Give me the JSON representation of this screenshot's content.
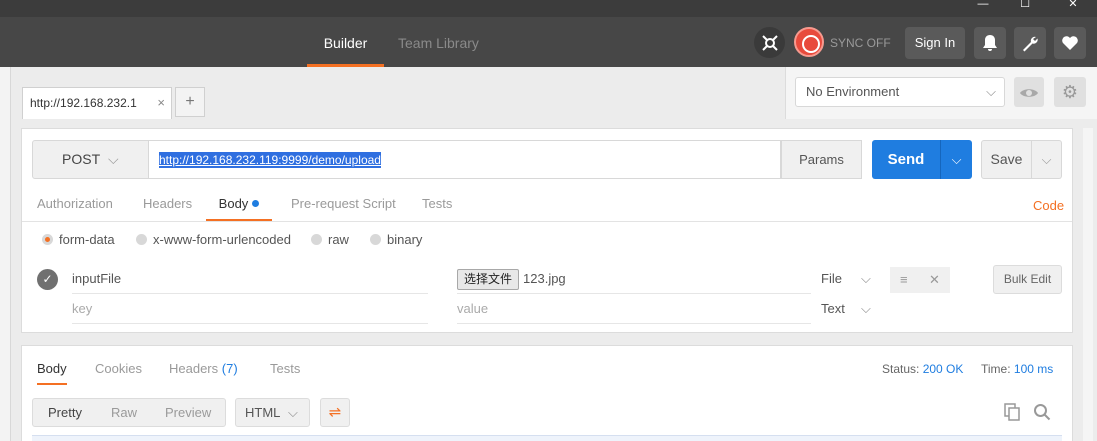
{
  "nav": {
    "builder": "Builder",
    "team_library": "Team Library",
    "sync": "SYNC OFF",
    "signin": "Sign In"
  },
  "tabs": {
    "request_tab": "http://192.168.232.1",
    "close": "×",
    "add": "+"
  },
  "environment": {
    "selected": "No Environment"
  },
  "request": {
    "method": "POST",
    "url": "http://192.168.232.119:9999/demo/upload",
    "params": "Params",
    "send": "Send",
    "save": "Save",
    "subtabs": [
      "Authorization",
      "Headers",
      "Body",
      "Pre-request Script",
      "Tests"
    ],
    "code": "Code",
    "body_modes": [
      "form-data",
      "x-www-form-urlencoded",
      "raw",
      "binary"
    ],
    "rows": [
      {
        "key": "inputFile",
        "file_button": "选择文件",
        "value": "123.jpg",
        "type": "File"
      },
      {
        "key_placeholder": "key",
        "value_placeholder": "value",
        "type": "Text"
      }
    ],
    "bulk_edit": "Bulk Edit"
  },
  "response": {
    "tabs": {
      "body": "Body",
      "cookies": "Cookies",
      "headers": "Headers",
      "headers_count": "(7)",
      "tests": "Tests"
    },
    "status_label": "Status:",
    "status_value": "200 OK",
    "time_label": "Time:",
    "time_value": "100 ms",
    "formats": [
      "Pretty",
      "Raw",
      "Preview"
    ],
    "language": "HTML"
  },
  "colors": {
    "accent": "#f47023",
    "primary": "#1f7de0",
    "nav_bg": "#474747"
  }
}
